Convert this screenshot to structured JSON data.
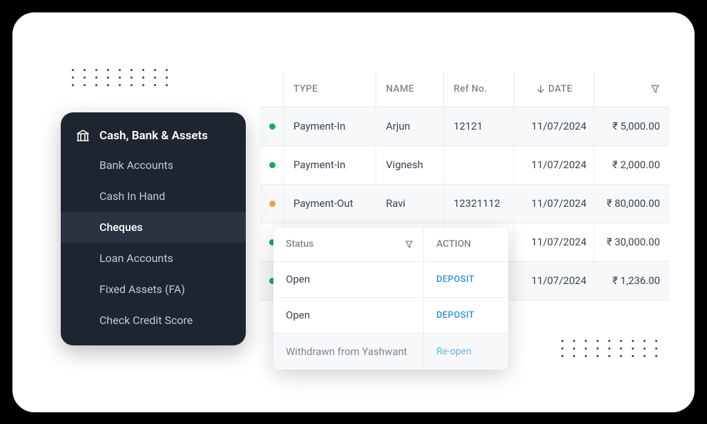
{
  "sidebar": {
    "title": "Cash, Bank & Assets",
    "items": [
      {
        "label": "Bank Accounts"
      },
      {
        "label": "Cash In Hand"
      },
      {
        "label": "Cheques"
      },
      {
        "label": "Loan Accounts"
      },
      {
        "label": "Fixed Assets (FA)"
      },
      {
        "label": "Check Credit Score"
      }
    ]
  },
  "table": {
    "headers": {
      "type": "TYPE",
      "name": "NAME",
      "ref": "Ref No.",
      "date": "DATE"
    },
    "rows": [
      {
        "status": "green",
        "type": "Payment-In",
        "name": "Arjun",
        "ref": "12121",
        "date": "11/07/2024",
        "amount": "₹ 5,000.00"
      },
      {
        "status": "green",
        "type": "Payment-In",
        "name": "Vignesh",
        "ref": "",
        "date": "11/07/2024",
        "amount": "₹ 2,000.00"
      },
      {
        "status": "orange",
        "type": "Payment-Out",
        "name": "Ravi",
        "ref": "12321112",
        "date": "11/07/2024",
        "amount": "₹ 80,000.00"
      },
      {
        "status": "green",
        "type": "",
        "name": "",
        "ref": "",
        "date": "11/07/2024",
        "amount": "₹ 30,000.00"
      },
      {
        "status": "green",
        "type": "",
        "name": "",
        "ref": "",
        "date": "11/07/2024",
        "amount": "₹ 1,236.00"
      }
    ]
  },
  "popup": {
    "headers": {
      "status": "Status",
      "action": "ACTION"
    },
    "rows": [
      {
        "status": "Open",
        "action": "DEPOSIT"
      },
      {
        "status": "Open",
        "action": "DEPOSIT"
      },
      {
        "status": "Withdrawn from Yashwant",
        "action": "Re-open"
      }
    ]
  }
}
